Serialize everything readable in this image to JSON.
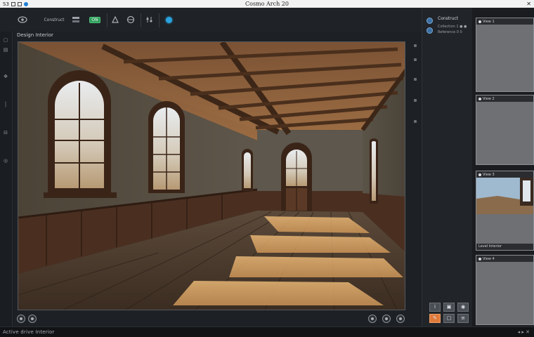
{
  "app": {
    "window_title": "Cosmo Arch 20",
    "titlebar_left": "S3",
    "close_glyph": "✕"
  },
  "toolbar": {
    "brand_label": "Construct",
    "green_badge": "ON",
    "tools": [
      "cube-icon",
      "layers-icon",
      "render-icon",
      "move-icon",
      "globe-icon",
      "sliders-icon",
      "pin-icon"
    ]
  },
  "viewport": {
    "title": "Design Interior",
    "scene": "Empty room with timber-beamed ceiling, arched windows, wooden wainscoting, plank floor and a double door at the far wall"
  },
  "panel": {
    "header": "Construct",
    "line1": "Collection 1 ● ●",
    "line2": "Reference 0 0"
  },
  "thumbnails": [
    {
      "label": "View 1",
      "footer": ""
    },
    {
      "label": "View 2",
      "footer": ""
    },
    {
      "label": "View 3",
      "footer": "Level Interior"
    },
    {
      "label": "View 4",
      "footer": ""
    }
  ],
  "status": {
    "left_text": "Active drive Interior",
    "right_text": "◂ ▸ ✕"
  },
  "colors": {
    "accent_green": "#2f9c5a",
    "accent_blue": "#2aa3e0",
    "accent_orange": "#e07a3a"
  }
}
